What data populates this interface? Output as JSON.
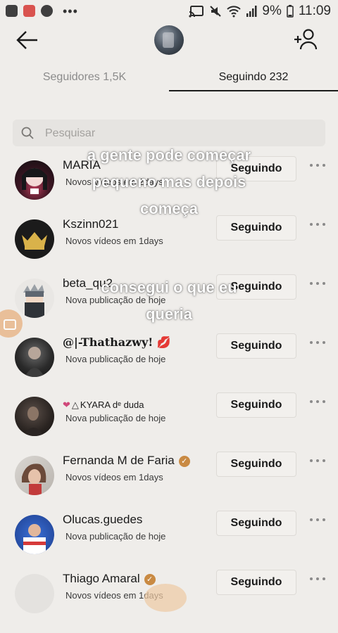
{
  "status_bar": {
    "battery": "9%",
    "time": "11:09",
    "notification_icons": [
      "video-call-icon",
      "app-grid-icon",
      "facebook-icon"
    ],
    "more": "•••"
  },
  "header": {
    "back_icon": "arrow-left-icon",
    "add_user_icon": "add-user-icon"
  },
  "tabs": [
    {
      "label": "Seguidores 1,5K",
      "active": false
    },
    {
      "label": "Seguindo 232",
      "active": true
    }
  ],
  "search": {
    "placeholder": "Pesquisar",
    "value": ""
  },
  "users": [
    {
      "name": "MARIA",
      "sub": "Novos vídeos em 2days",
      "button": "Seguindo",
      "verified": false
    },
    {
      "name": "Kszinn021",
      "sub": "Novos vídeos em 1days",
      "button": "Seguindo",
      "verified": false
    },
    {
      "name": "beta_qu2",
      "sub": "Nova publicação de hoje",
      "button": "Seguindo",
      "verified": false
    },
    {
      "name": "@|-Thathazwy! 💋",
      "sub": "Nova publicação de hoje",
      "button": "Seguindo",
      "verified": false
    },
    {
      "name": "KYARA dᵉ duda",
      "sub": "Nova publicação de hoje",
      "button": "Seguindo",
      "verified": false
    },
    {
      "name": "Fernanda M de Faria",
      "sub": "Novos vídeos em 1days",
      "button": "Seguindo",
      "verified": true
    },
    {
      "name": "Olucas.guedes",
      "sub": "Nova publicação de hoje",
      "button": "Seguindo",
      "verified": false
    },
    {
      "name": "Thiago Amaral",
      "sub": "Novos vídeos em 1days",
      "button": "Seguindo",
      "verified": true
    }
  ],
  "overlay_text": {
    "line1": "a gente pode começar",
    "line2": "pequeno mas depois",
    "line3": "começa",
    "line4": "consegui o que eu",
    "line5": "queria"
  },
  "colors": {
    "background": "#efedea",
    "verified_badge": "#c98a43",
    "tab_indicator": "#1b1b1b"
  }
}
